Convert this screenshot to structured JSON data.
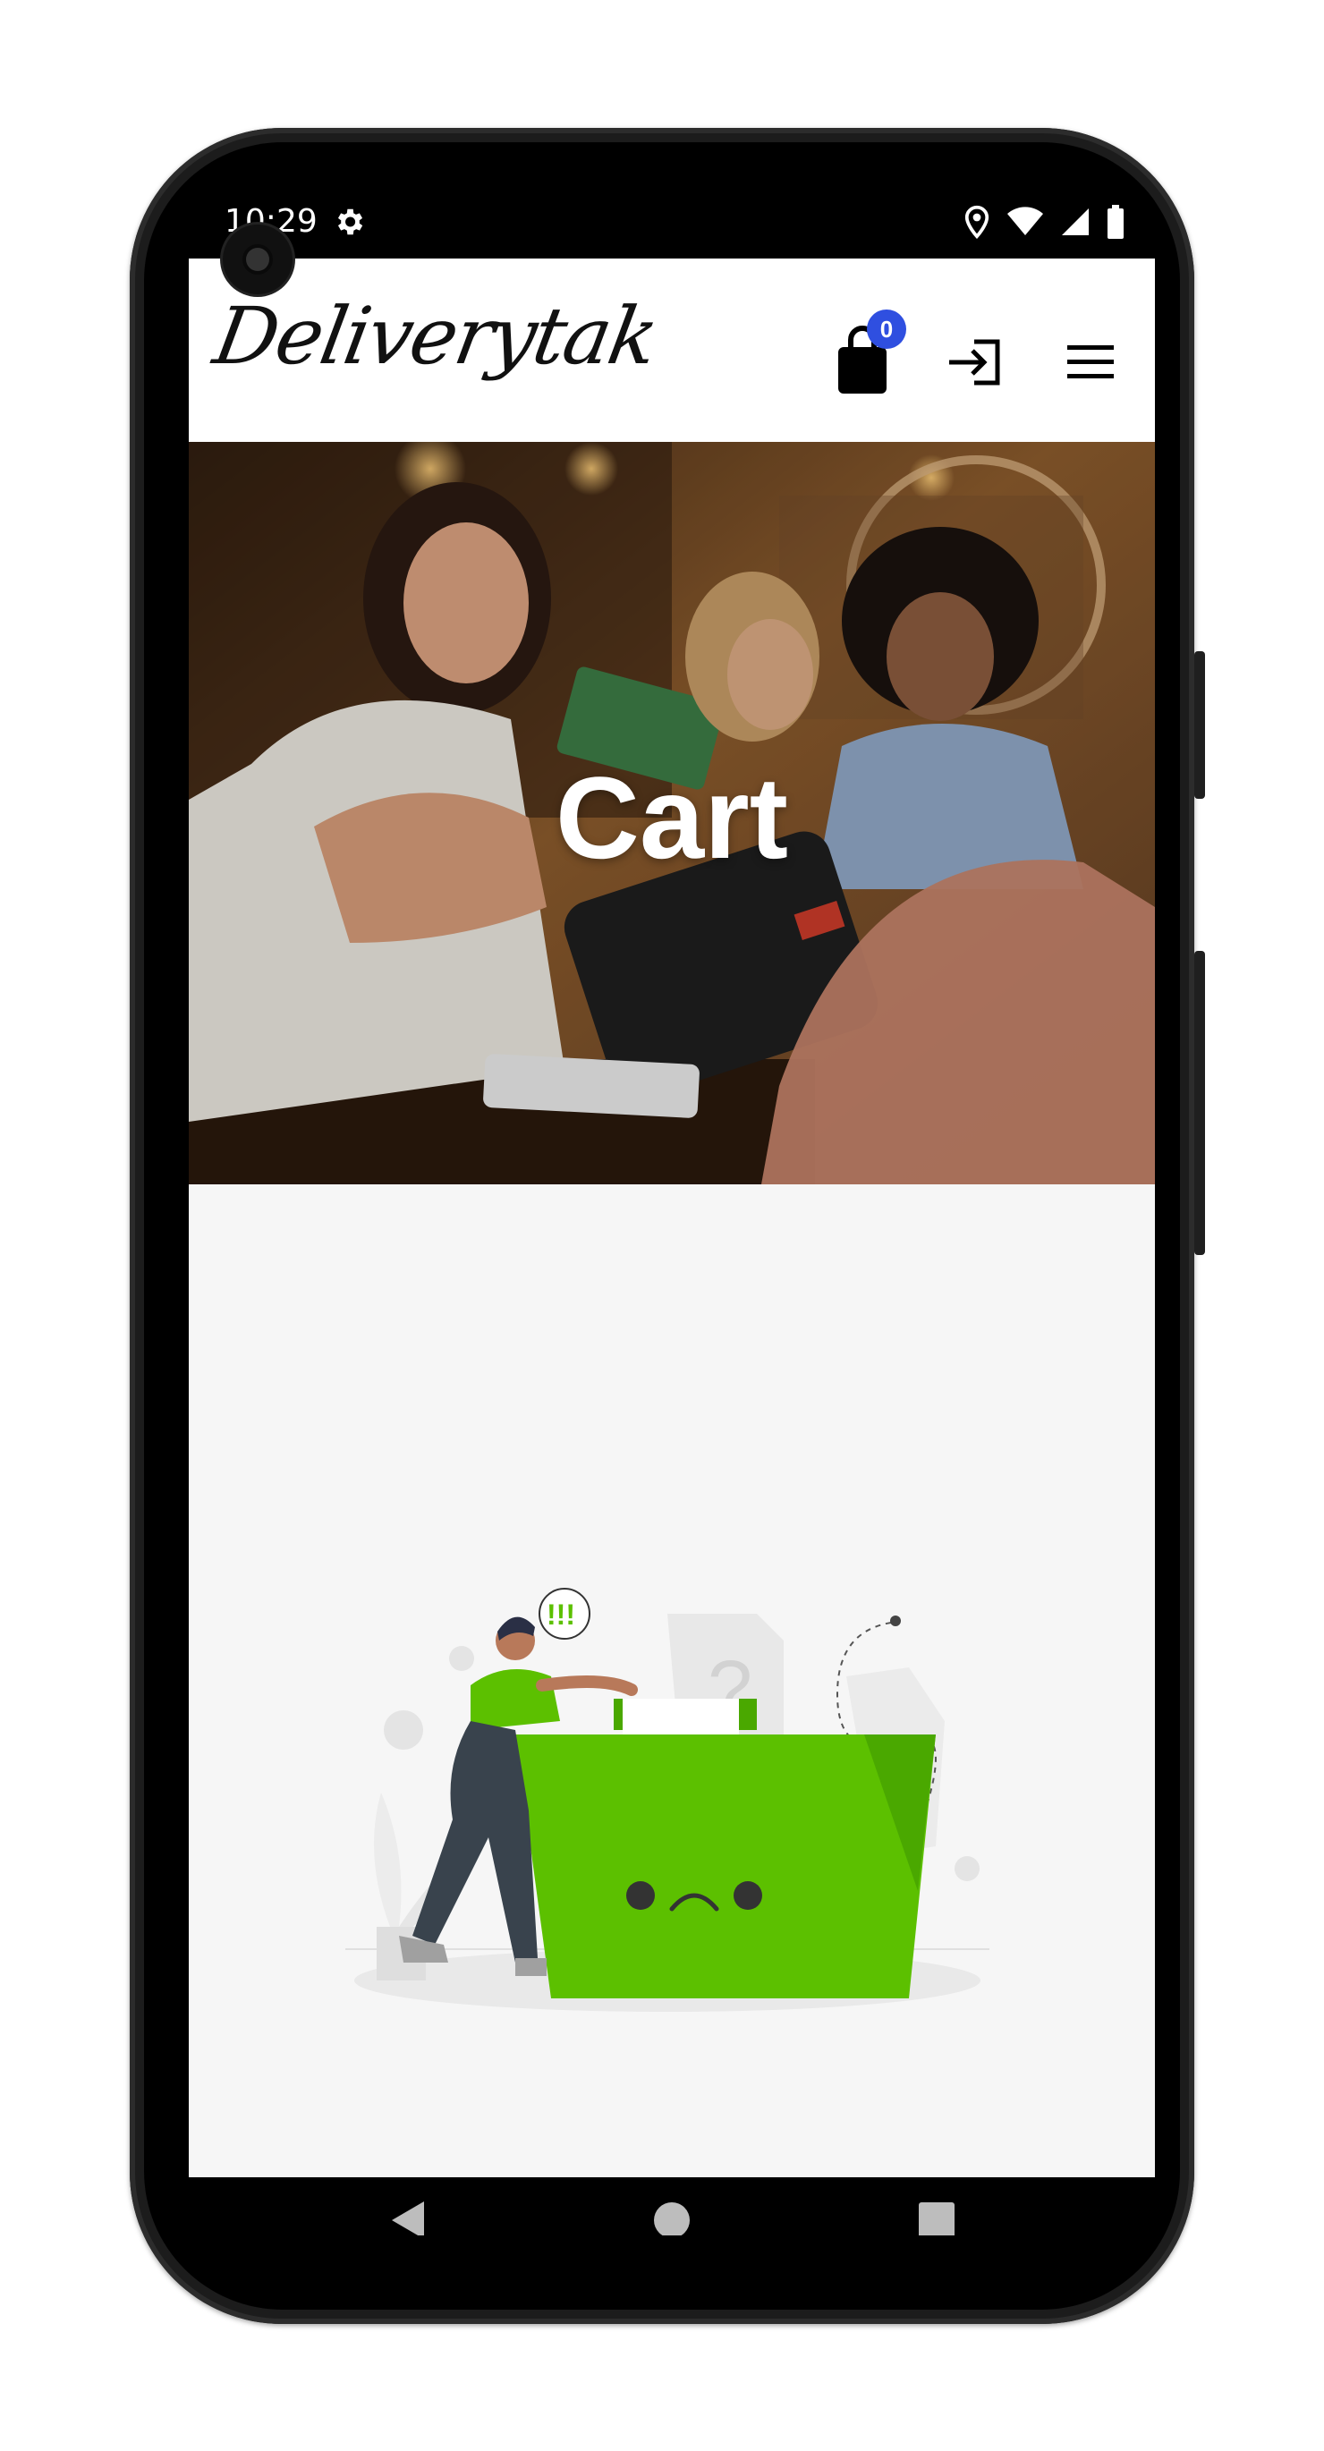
{
  "status": {
    "time": "10:29"
  },
  "header": {
    "logo": "Deliverytak",
    "cart_count": "0"
  },
  "hero": {
    "title": "Cart"
  },
  "colors": {
    "accent": "#2f4fe0",
    "illustration_green": "#5cc000",
    "background": "#f6f6f6"
  },
  "icons": {
    "status": [
      "gear-icon",
      "location-icon",
      "wifi-icon",
      "signal-icon",
      "battery-icon"
    ],
    "header": [
      "shopping-bag-icon",
      "login-icon",
      "hamburger-menu-icon"
    ],
    "nav": [
      "back-icon",
      "home-icon",
      "recents-icon"
    ]
  },
  "illustration": {
    "bubble_text": "!!!",
    "question_mark": "?"
  }
}
